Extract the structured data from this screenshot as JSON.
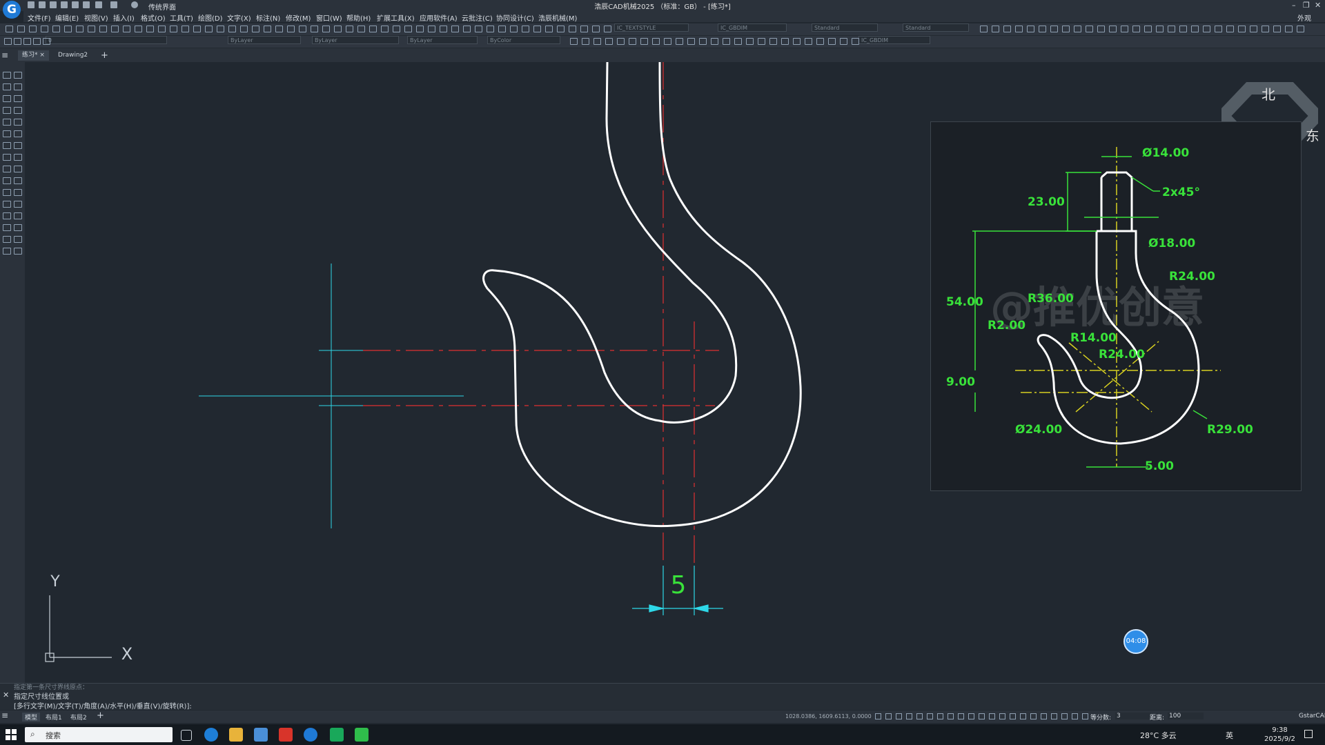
{
  "window": {
    "title": "浩辰CAD机械2025 （标准：GB） - [练习*]",
    "workspace": "传统界面",
    "controls": [
      "–",
      "❐",
      "✕"
    ]
  },
  "menu": {
    "items": [
      "文件(F)",
      "编辑(E)",
      "视图(V)",
      "插入(I)",
      "格式(O)",
      "工具(T)",
      "绘图(D)",
      "文字(X)",
      "标注(N)",
      "修改(M)",
      "窗口(W)",
      "帮助(H)",
      "扩展工具(X)",
      "应用软件(A)",
      "云批注(C)",
      "协同设计(C)",
      "浩辰机械(M)"
    ],
    "appearance": "外观"
  },
  "toolbars": {
    "text_style": "IC_TEXTSTYLE",
    "dim_style": "IC_GBDIM",
    "table_style": "Standard",
    "multileader_style": "Standard",
    "layer": "0",
    "color": "ByLayer",
    "linetype": "ByLayer",
    "lineweight": "ByLayer",
    "plot_style": "ByColor",
    "dim_style_2": "IC_GBDIM"
  },
  "tabs": {
    "active": "练习*",
    "close": "×",
    "second": "Drawing2",
    "add": "+"
  },
  "command": {
    "history": "指定第一条尺寸界线原点：",
    "line1": "指定尺寸线位置或",
    "line2": "[多行文字(M)/文字(T)/角度(A)/水平(H)/垂直(V)/旋转(R)]:"
  },
  "layout_tabs": [
    "模型",
    "布局1",
    "布局2",
    "+"
  ],
  "status": {
    "coordinates": "1028.0386, 1609.6113, 0.0000",
    "equal_label": "等分数:",
    "equal_value": "3",
    "distance_label": "距离:",
    "distance_value": "100",
    "brand": "GstarCAD"
  },
  "canvas": {
    "dimension_value": "5",
    "ucs_x": "X",
    "ucs_y": "Y",
    "nav_north": "北",
    "nav_east": "东"
  },
  "reference": {
    "dims": [
      "Ø14.00",
      "2x45°",
      "23.00",
      "Ø18.00",
      "R24.00",
      "54.00",
      "R36.00",
      "R2.00",
      "R14.00",
      "R24.00",
      "9.00",
      "Ø24.00",
      "R29.00",
      "5.00"
    ],
    "watermark": "@推优创意"
  },
  "timer": "04:08",
  "taskbar": {
    "search_label": "搜索",
    "weather": "28°C  多云",
    "ime": "英",
    "time": "9:38",
    "date": "2025/9/2"
  },
  "colors": {
    "background": "#212830",
    "geometry": "#ffffff",
    "center_line": "#e03030",
    "dimension": "#2ed8e8",
    "ref_dimension": "#39e23a",
    "ref_center": "#d8d020"
  }
}
